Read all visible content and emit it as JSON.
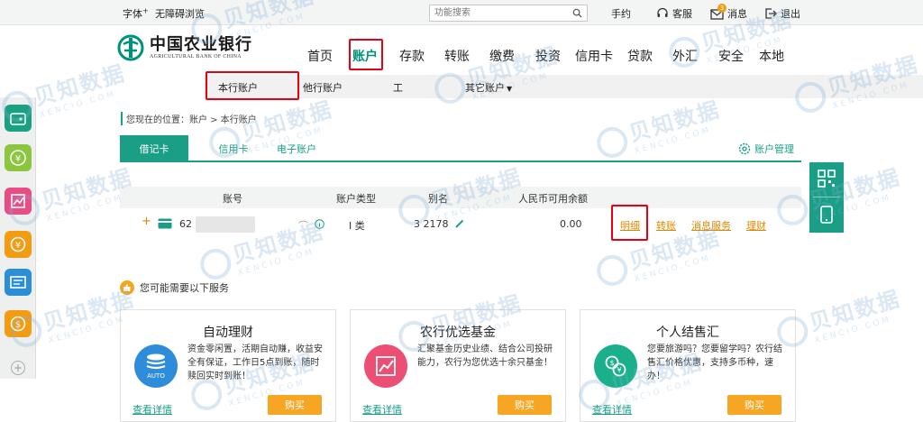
{
  "topbar": {
    "font_size": "字体",
    "font_size_sup": "+",
    "accessibility": "无障碍浏览",
    "search_placeholder": "功能搜索",
    "help": "手约",
    "service": "客服",
    "messages": "消息",
    "message_badge": "3",
    "logout": "退出"
  },
  "logo": {
    "cn": "中国农业银行",
    "en": "AGRICULTURAL BANK OF CHINA"
  },
  "nav": {
    "home": "首页",
    "account": "账户",
    "deposit": "存款",
    "transfer": "转账",
    "payment": "缴费",
    "invest": "投资",
    "credit_card": "信用卡",
    "loan": "贷款",
    "forex": "外汇",
    "security": "安全",
    "local": "本地"
  },
  "subnav": {
    "own": "本行账户",
    "other": "他行账户",
    "third": "工",
    "more": "其它账户"
  },
  "breadcrumb": "您现在的位置：账户 > 本行账户",
  "tabs": {
    "debit": "借记卡",
    "credit": "信用卡",
    "electronic": "电子账户",
    "manage": "账户管理"
  },
  "table": {
    "headers": {
      "account": "账号",
      "type": "账户类型",
      "alias": "别名",
      "balance": "人民币可用余额"
    },
    "row": {
      "account": "62",
      "type": "I 类",
      "alias": "3  2178",
      "balance": "0.00",
      "actions": {
        "detail": "明细",
        "transfer": "转账",
        "message": "消息服务",
        "wealth": "理财"
      }
    }
  },
  "service_hint": "您可能需要以下服务",
  "cards": [
    {
      "title": "自动理财",
      "desc": "资金零闲置，活期自动赚，收益安全有保证，工作日5点到账，随时赎回实时到账！",
      "more": "查看详情",
      "buy": "购买",
      "icon_label": "AUTO"
    },
    {
      "title": "农行优选基金",
      "desc": "汇聚基金历史业绩、结合公司投研能力，农行为您优选十余只基金！",
      "more": "查看详情",
      "buy": "购买"
    },
    {
      "title": "个人结售汇",
      "desc": "您要旅游吗？您要留学吗？农行结售汇价格优惠，支持多币种，速办！",
      "more": "查看详情",
      "buy": "购买"
    }
  ],
  "watermark": {
    "cn": "贝知数据",
    "en": "XENCIO.COM"
  },
  "colors": {
    "brand": "#1b9e86",
    "link": "#e08700",
    "highlight": "#e60012",
    "buy": "#f6a623"
  }
}
